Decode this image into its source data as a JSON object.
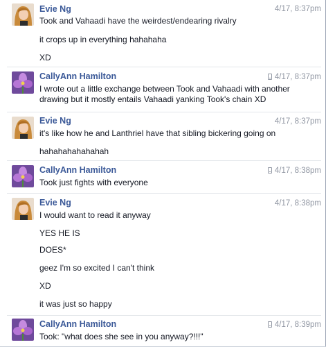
{
  "messages": [
    {
      "sender": "Evie Ng",
      "time": "4/17, 8:37pm",
      "mobile": false,
      "avatar": "evie",
      "lines": [
        "Took and Vahaadi have the weirdest/endearing rivalry",
        "it crops up in everything hahahaha",
        "XD"
      ]
    },
    {
      "sender": "CallyAnn Hamilton",
      "time": "4/17, 8:37pm",
      "mobile": true,
      "avatar": "cally",
      "lines": [
        "I wrote out a little exchange between Took and Vahaadi with another drawing but it mostly entails Vahaadi yanking Took's chain XD"
      ]
    },
    {
      "sender": "Evie Ng",
      "time": "4/17, 8:37pm",
      "mobile": false,
      "avatar": "evie",
      "lines": [
        "it's like how he and Lanthriel have that sibling bickering going on",
        "hahahahahahahah"
      ]
    },
    {
      "sender": "CallyAnn Hamilton",
      "time": "4/17, 8:38pm",
      "mobile": true,
      "avatar": "cally",
      "lines": [
        "Took just fights with everyone"
      ]
    },
    {
      "sender": "Evie Ng",
      "time": "4/17, 8:38pm",
      "mobile": false,
      "avatar": "evie",
      "lines": [
        "I would want to read it anyway",
        "YES HE IS",
        "DOES*",
        "geez I'm so excited I can't think",
        "XD",
        "it was just so happy"
      ]
    },
    {
      "sender": "CallyAnn Hamilton",
      "time": "4/17, 8:39pm",
      "mobile": true,
      "avatar": "cally",
      "lines": [
        "Took: \"what does she see in you anyway?!!!\""
      ]
    }
  ]
}
